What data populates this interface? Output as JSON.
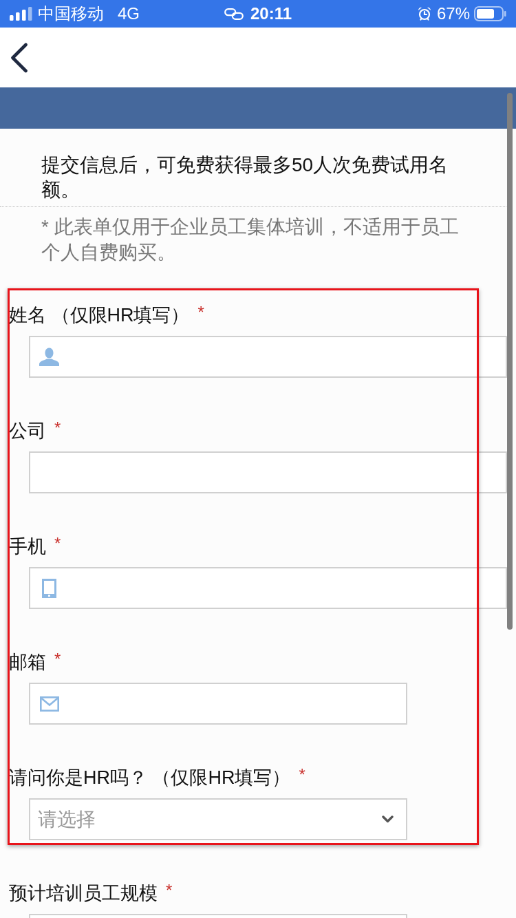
{
  "status_bar": {
    "carrier": "中国移动",
    "network": "4G",
    "time": "20:11",
    "battery": "67%"
  },
  "intro": {
    "text": "提交信息后，可免费获得最多50人次免费试用名额。",
    "note": "* 此表单仅用于企业员工集体培训，不适用于员工个人自费购买。"
  },
  "form": {
    "fields": [
      {
        "label": "姓名 （仅限HR填写）",
        "required_mark": "*",
        "kind": "name",
        "highlighted": true
      },
      {
        "label": "公司",
        "required_mark": "*",
        "kind": "text",
        "highlighted": true
      },
      {
        "label": "手机",
        "required_mark": "*",
        "kind": "phone",
        "highlighted": true
      },
      {
        "label": "邮箱",
        "required_mark": "*",
        "kind": "email",
        "highlighted": true
      },
      {
        "label": "请问你是HR吗？ （仅限HR填写）",
        "required_mark": "*",
        "kind": "select",
        "placeholder": "请选择",
        "highlighted": true
      },
      {
        "label": "预计培训员工规模",
        "required_mark": "*",
        "kind": "blank",
        "highlighted": false
      }
    ]
  }
}
